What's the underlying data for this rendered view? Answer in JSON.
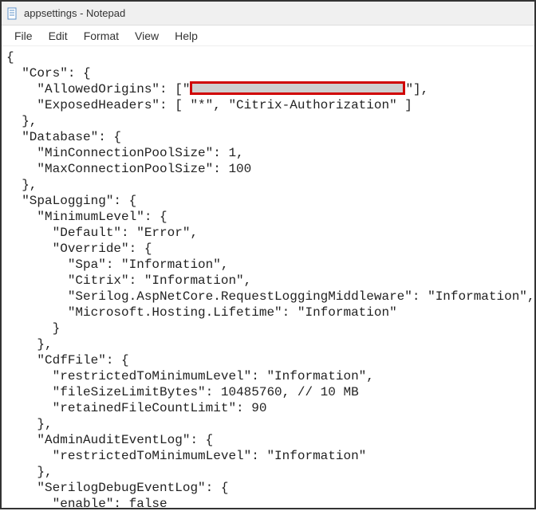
{
  "window": {
    "title": "appsettings - Notepad"
  },
  "menu": {
    "file": "File",
    "edit": "Edit",
    "format": "Format",
    "view": "View",
    "help": "Help"
  },
  "code": {
    "l1": "{",
    "l2": "  \"Cors\": {",
    "l3a": "    \"AllowedOrigins\": [\"",
    "l3b": "\"],",
    "l4": "    \"ExposedHeaders\": [ \"*\", \"Citrix-Authorization\" ]",
    "l5": "  },",
    "l6": "  \"Database\": {",
    "l7": "    \"MinConnectionPoolSize\": 1,",
    "l8": "    \"MaxConnectionPoolSize\": 100",
    "l9": "  },",
    "l10": "  \"SpaLogging\": {",
    "l11": "    \"MinimumLevel\": {",
    "l12": "      \"Default\": \"Error\",",
    "l13": "      \"Override\": {",
    "l14": "        \"Spa\": \"Information\",",
    "l15": "        \"Citrix\": \"Information\",",
    "l16": "        \"Serilog.AspNetCore.RequestLoggingMiddleware\": \"Information\",",
    "l17": "        \"Microsoft.Hosting.Lifetime\": \"Information\"",
    "l18": "      }",
    "l19": "    },",
    "l20": "    \"CdfFile\": {",
    "l21": "      \"restrictedToMinimumLevel\": \"Information\",",
    "l22": "      \"fileSizeLimitBytes\": 10485760, // 10 MB",
    "l23": "      \"retainedFileCountLimit\": 90",
    "l24": "    },",
    "l25": "    \"AdminAuditEventLog\": {",
    "l26": "      \"restrictedToMinimumLevel\": \"Information\"",
    "l27": "    },",
    "l28": "    \"SerilogDebugEventLog\": {",
    "l29": "      \"enable\": false"
  }
}
